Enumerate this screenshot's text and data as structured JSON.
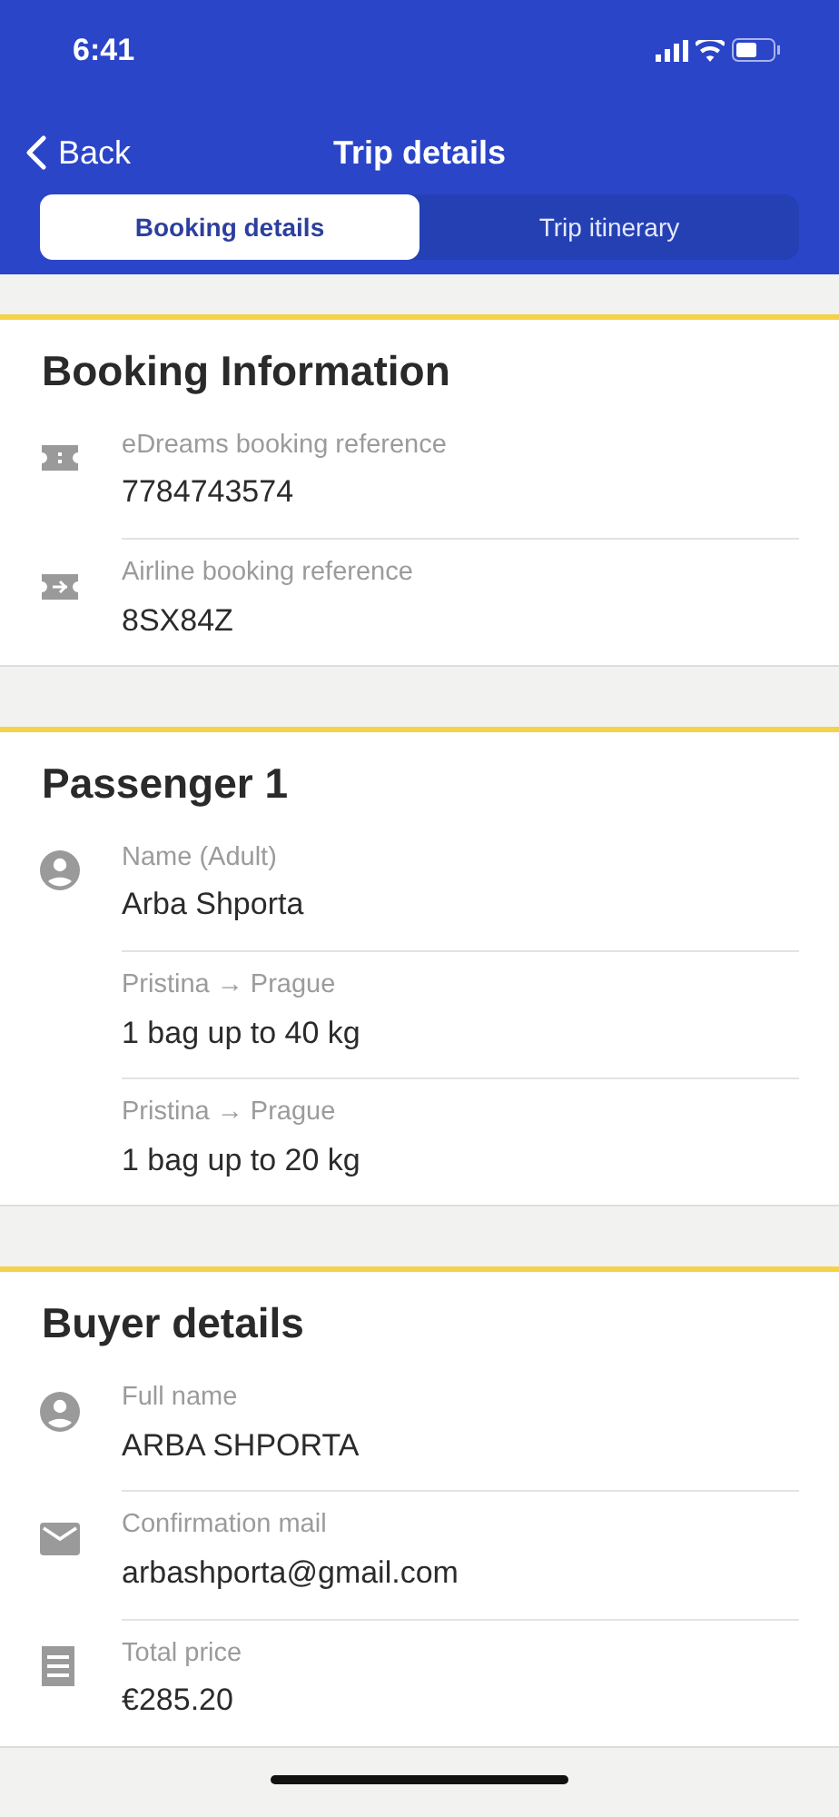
{
  "status_bar": {
    "time": "6:41"
  },
  "nav": {
    "back": "Back",
    "title": "Trip details"
  },
  "tabs": [
    {
      "label": "Booking details",
      "selected": true
    },
    {
      "label": "Trip itinerary",
      "selected": false
    }
  ],
  "sections": [
    {
      "title": "Booking Information",
      "rows": [
        {
          "kind": "ticket",
          "label": "eDreams booking reference",
          "value": "7784743574"
        },
        {
          "kind": "flight-ticket",
          "label": "Airline booking reference",
          "value": "8SX84Z"
        }
      ]
    },
    {
      "title": "Passenger 1",
      "rows": [
        {
          "kind": "person",
          "label": "Name (Adult)",
          "value": "Arba Shporta"
        },
        {
          "kind": "none",
          "label": "Pristina → Prague",
          "value": "1 bag up to 40 kg"
        },
        {
          "kind": "none",
          "label": "Pristina → Prague",
          "value": "1 bag up to 20 kg"
        }
      ]
    },
    {
      "title": "Buyer details",
      "rows": [
        {
          "kind": "person",
          "label": "Full name",
          "value": "ARBA SHPORTA"
        },
        {
          "kind": "mail",
          "label": "Confirmation mail",
          "value": "arbashporta@gmail.com"
        },
        {
          "kind": "receipt",
          "label": "Total price",
          "value": "€285.20"
        }
      ]
    }
  ]
}
